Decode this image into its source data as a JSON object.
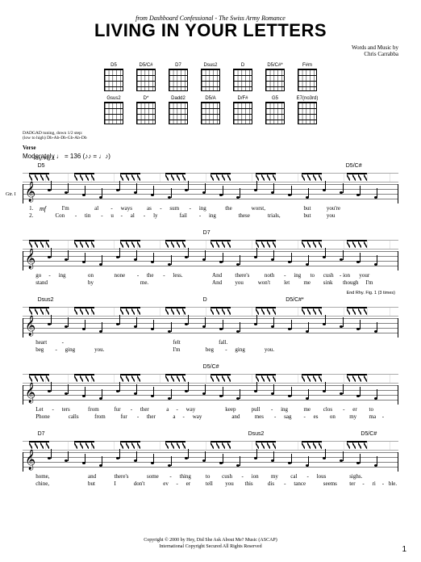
{
  "header": {
    "source_prefix": "from Dashboard Confessional - ",
    "album": "The Swiss Army Romance",
    "title": "LIVING IN YOUR LETTERS",
    "credits_line1": "Words and Music by",
    "credits_line2": "Chris Carrabba"
  },
  "chords": {
    "row1": [
      "D5",
      "D5/C#",
      "D7",
      "Dsus2",
      "D",
      "D5/C#*",
      "F#m"
    ],
    "row2": [
      "Gsus2",
      "D*",
      "Dadd2",
      "D5/A",
      "D/F#",
      "G5",
      "E7(no3rd)"
    ]
  },
  "tuning": {
    "line1": "DADGAD tuning, down 1/2 step:",
    "line2": "(low to high) Db-Ab-Db-Gb-Ab-Db"
  },
  "section": "Verse",
  "tempo": "Moderately ♩ = 136  (♪♪ = ♩♪)",
  "gtr_label": "Gtr. I\n(acous.)",
  "dynamic": "mf",
  "rhy_fig": "Rhy. Fig. 1",
  "end_rhy": "End Rhy. Fig. 1 (3 times)",
  "systems": [
    {
      "chords": [
        {
          "pos": 4,
          "label": "D5"
        },
        {
          "pos": 86,
          "label": "D5/C#"
        }
      ],
      "lyrics": [
        {
          "n": "1.",
          "pos": 2,
          "row": 1
        },
        {
          "t": "I'm",
          "pos": 12,
          "row": 1
        },
        {
          "t": "al",
          "pos": 22,
          "row": 1
        },
        {
          "t": "-",
          "pos": 27,
          "row": 1
        },
        {
          "t": "ways",
          "pos": 30,
          "row": 1
        },
        {
          "t": "as",
          "pos": 38,
          "row": 1
        },
        {
          "t": "-",
          "pos": 42,
          "row": 1
        },
        {
          "t": "sum",
          "pos": 45,
          "row": 1
        },
        {
          "t": "-",
          "pos": 51,
          "row": 1
        },
        {
          "t": "ing",
          "pos": 54,
          "row": 1
        },
        {
          "t": "the",
          "pos": 62,
          "row": 1
        },
        {
          "t": "worst,",
          "pos": 70,
          "row": 1
        },
        {
          "t": "but",
          "pos": 86,
          "row": 1
        },
        {
          "t": "you're",
          "pos": 93,
          "row": 1
        },
        {
          "n": "2.",
          "pos": 2,
          "row": 2
        },
        {
          "t": "Con",
          "pos": 10,
          "row": 2
        },
        {
          "t": "-",
          "pos": 16,
          "row": 2
        },
        {
          "t": "tin",
          "pos": 19,
          "row": 2
        },
        {
          "t": "-",
          "pos": 24,
          "row": 2
        },
        {
          "t": "u",
          "pos": 27,
          "row": 2
        },
        {
          "t": "-",
          "pos": 30,
          "row": 2
        },
        {
          "t": "al",
          "pos": 33,
          "row": 2
        },
        {
          "t": "-",
          "pos": 37,
          "row": 2
        },
        {
          "t": "ly",
          "pos": 40,
          "row": 2
        },
        {
          "t": "fail",
          "pos": 48,
          "row": 2
        },
        {
          "t": "-",
          "pos": 54,
          "row": 2
        },
        {
          "t": "ing",
          "pos": 57,
          "row": 2
        },
        {
          "t": "these",
          "pos": 66,
          "row": 2
        },
        {
          "t": "trials,",
          "pos": 75,
          "row": 2
        },
        {
          "t": "but",
          "pos": 86,
          "row": 2
        },
        {
          "t": "you",
          "pos": 93,
          "row": 2
        }
      ]
    },
    {
      "chords": [
        {
          "pos": 48,
          "label": "D7"
        }
      ],
      "lyrics": [
        {
          "t": "go",
          "pos": 4,
          "row": 1
        },
        {
          "t": "-",
          "pos": 8,
          "row": 1
        },
        {
          "t": "ing",
          "pos": 11,
          "row": 1
        },
        {
          "t": "on",
          "pos": 20,
          "row": 1
        },
        {
          "t": "none",
          "pos": 28,
          "row": 1
        },
        {
          "t": "-",
          "pos": 35,
          "row": 1
        },
        {
          "t": "the",
          "pos": 38,
          "row": 1
        },
        {
          "t": "-",
          "pos": 43,
          "row": 1
        },
        {
          "t": "less.",
          "pos": 46,
          "row": 1
        },
        {
          "t": "And",
          "pos": 58,
          "row": 1
        },
        {
          "t": "there's",
          "pos": 65,
          "row": 1
        },
        {
          "t": "noth",
          "pos": 74,
          "row": 1
        },
        {
          "t": "-",
          "pos": 80,
          "row": 1
        },
        {
          "t": "ing",
          "pos": 83,
          "row": 1
        },
        {
          "t": "to",
          "pos": 88,
          "row": 1
        },
        {
          "t": "cush",
          "pos": 92,
          "row": 1
        },
        {
          "t": "-",
          "pos": 97,
          "row": 1
        },
        {
          "t": "ion",
          "pos": 98,
          "row": 1
        },
        {
          "t": "your",
          "pos": 103,
          "row": 1
        },
        {
          "t": "stand",
          "pos": 4,
          "row": 2
        },
        {
          "t": "by",
          "pos": 20,
          "row": 2
        },
        {
          "t": "me.",
          "pos": 36,
          "row": 2
        },
        {
          "t": "And",
          "pos": 58,
          "row": 2
        },
        {
          "t": "you",
          "pos": 65,
          "row": 2
        },
        {
          "t": "won't",
          "pos": 72,
          "row": 2
        },
        {
          "t": "let",
          "pos": 80,
          "row": 2
        },
        {
          "t": "me",
          "pos": 86,
          "row": 2
        },
        {
          "t": "sink",
          "pos": 92,
          "row": 2
        },
        {
          "t": "though",
          "pos": 98,
          "row": 2
        },
        {
          "t": "I'm",
          "pos": 105,
          "row": 2
        }
      ]
    },
    {
      "chords": [
        {
          "pos": 4,
          "label": "Dsus2"
        },
        {
          "pos": 48,
          "label": "D"
        },
        {
          "pos": 70,
          "label": "D5/C#*"
        }
      ],
      "end_rhy": true,
      "lyrics": [
        {
          "t": "heart",
          "pos": 4,
          "row": 1
        },
        {
          "t": "-",
          "pos": 12,
          "row": 1
        },
        {
          "t": "felt",
          "pos": 46,
          "row": 1
        },
        {
          "t": "fall.",
          "pos": 60,
          "row": 1
        },
        {
          "t": "beg",
          "pos": 4,
          "row": 2
        },
        {
          "t": "-",
          "pos": 10,
          "row": 2
        },
        {
          "t": "ging",
          "pos": 13,
          "row": 2
        },
        {
          "t": "you.",
          "pos": 22,
          "row": 2
        },
        {
          "t": "I'm",
          "pos": 46,
          "row": 2
        },
        {
          "t": "beg",
          "pos": 56,
          "row": 2
        },
        {
          "t": "-",
          "pos": 62,
          "row": 2
        },
        {
          "t": "ging",
          "pos": 65,
          "row": 2
        },
        {
          "t": "you.",
          "pos": 74,
          "row": 2
        }
      ]
    },
    {
      "chords": [
        {
          "pos": 48,
          "label": "D5/C#"
        }
      ],
      "lyrics": [
        {
          "t": "Let",
          "pos": 4,
          "row": 1
        },
        {
          "t": "-",
          "pos": 9,
          "row": 1
        },
        {
          "t": "ters",
          "pos": 12,
          "row": 1
        },
        {
          "t": "from",
          "pos": 20,
          "row": 1
        },
        {
          "t": "fur",
          "pos": 28,
          "row": 1
        },
        {
          "t": "-",
          "pos": 33,
          "row": 1
        },
        {
          "t": "ther",
          "pos": 36,
          "row": 1
        },
        {
          "t": "a",
          "pos": 44,
          "row": 1
        },
        {
          "t": "-",
          "pos": 47,
          "row": 1
        },
        {
          "t": "way",
          "pos": 50,
          "row": 1
        },
        {
          "t": "keep",
          "pos": 62,
          "row": 1
        },
        {
          "t": "pull",
          "pos": 70,
          "row": 1
        },
        {
          "t": "-",
          "pos": 76,
          "row": 1
        },
        {
          "t": "ing",
          "pos": 79,
          "row": 1
        },
        {
          "t": "me",
          "pos": 86,
          "row": 1
        },
        {
          "t": "clos",
          "pos": 92,
          "row": 1
        },
        {
          "t": "-",
          "pos": 98,
          "row": 1
        },
        {
          "t": "er",
          "pos": 101,
          "row": 1
        },
        {
          "t": "to",
          "pos": 106,
          "row": 1
        },
        {
          "t": "Phone",
          "pos": 4,
          "row": 2
        },
        {
          "t": "calls",
          "pos": 14,
          "row": 2
        },
        {
          "t": "from",
          "pos": 22,
          "row": 2
        },
        {
          "t": "fur",
          "pos": 30,
          "row": 2
        },
        {
          "t": "-",
          "pos": 35,
          "row": 2
        },
        {
          "t": "ther",
          "pos": 38,
          "row": 2
        },
        {
          "t": "a",
          "pos": 46,
          "row": 2
        },
        {
          "t": "-",
          "pos": 49,
          "row": 2
        },
        {
          "t": "way",
          "pos": 52,
          "row": 2
        },
        {
          "t": "and",
          "pos": 64,
          "row": 2
        },
        {
          "t": "mes",
          "pos": 71,
          "row": 2
        },
        {
          "t": "-",
          "pos": 77,
          "row": 2
        },
        {
          "t": "sag",
          "pos": 80,
          "row": 2
        },
        {
          "t": "-",
          "pos": 86,
          "row": 2
        },
        {
          "t": "es",
          "pos": 89,
          "row": 2
        },
        {
          "t": "on",
          "pos": 94,
          "row": 2
        },
        {
          "t": "my",
          "pos": 100,
          "row": 2
        },
        {
          "t": "ma",
          "pos": 106,
          "row": 2
        },
        {
          "t": "-",
          "pos": 110,
          "row": 2
        }
      ]
    },
    {
      "chords": [
        {
          "pos": 4,
          "label": "D7"
        },
        {
          "pos": 60,
          "label": "Dsus2"
        },
        {
          "pos": 90,
          "label": "D5/C#"
        }
      ],
      "lyrics": [
        {
          "t": "home,",
          "pos": 4,
          "row": 1
        },
        {
          "t": "and",
          "pos": 20,
          "row": 1
        },
        {
          "t": "there's",
          "pos": 28,
          "row": 1
        },
        {
          "t": "some",
          "pos": 38,
          "row": 1
        },
        {
          "t": "-",
          "pos": 45,
          "row": 1
        },
        {
          "t": "thing",
          "pos": 48,
          "row": 1
        },
        {
          "t": "to",
          "pos": 56,
          "row": 1
        },
        {
          "t": "cush",
          "pos": 61,
          "row": 1
        },
        {
          "t": "-",
          "pos": 67,
          "row": 1
        },
        {
          "t": "ion",
          "pos": 70,
          "row": 1
        },
        {
          "t": "my",
          "pos": 76,
          "row": 1
        },
        {
          "t": "cal",
          "pos": 82,
          "row": 1
        },
        {
          "t": "-",
          "pos": 87,
          "row": 1
        },
        {
          "t": "lous",
          "pos": 90,
          "row": 1
        },
        {
          "t": "sighs.",
          "pos": 100,
          "row": 1
        },
        {
          "t": "chine,",
          "pos": 4,
          "row": 2
        },
        {
          "t": "but",
          "pos": 20,
          "row": 2
        },
        {
          "t": "I",
          "pos": 28,
          "row": 2
        },
        {
          "t": "don't",
          "pos": 34,
          "row": 2
        },
        {
          "t": "ev",
          "pos": 43,
          "row": 2
        },
        {
          "t": "-",
          "pos": 47,
          "row": 2
        },
        {
          "t": "er",
          "pos": 50,
          "row": 2
        },
        {
          "t": "tell",
          "pos": 56,
          "row": 2
        },
        {
          "t": "you",
          "pos": 62,
          "row": 2
        },
        {
          "t": "this",
          "pos": 68,
          "row": 2
        },
        {
          "t": "dis",
          "pos": 75,
          "row": 2
        },
        {
          "t": "-",
          "pos": 80,
          "row": 2
        },
        {
          "t": "tance",
          "pos": 83,
          "row": 2
        },
        {
          "t": "seems",
          "pos": 92,
          "row": 2
        },
        {
          "t": "ter",
          "pos": 100,
          "row": 2
        },
        {
          "t": "-",
          "pos": 104,
          "row": 2
        },
        {
          "t": "ri",
          "pos": 107,
          "row": 2
        },
        {
          "t": "-",
          "pos": 110,
          "row": 2
        },
        {
          "t": "ble.",
          "pos": 112,
          "row": 2
        }
      ]
    }
  ],
  "footer": {
    "line1": "Copyright © 2000 by Hey, Did She Ask About Me? Music (ASCAP)",
    "line2": "International Copyright Secured   All Rights Reserved"
  },
  "page_number": "1"
}
